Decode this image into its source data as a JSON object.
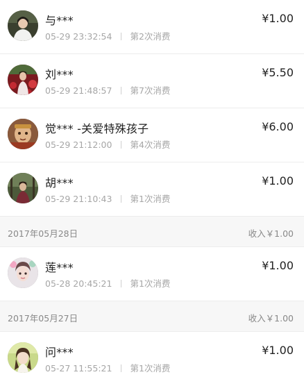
{
  "records_group_1": [
    {
      "name": "与***",
      "time": "05-29 23:32:54",
      "count": "第2次消费",
      "amount": "¥1.00",
      "avatar": "avatar-photo"
    },
    {
      "name": "刘***",
      "time": "05-29 21:48:57",
      "count": "第7次消费",
      "amount": "¥5.50",
      "avatar": "avatar-photo"
    },
    {
      "name": "觉*** -关爱特殊孩子",
      "time": "05-29 21:12:00",
      "count": "第4次消费",
      "amount": "¥6.00",
      "avatar": "avatar-photo"
    },
    {
      "name": "胡***",
      "time": "05-29 21:10:43",
      "count": "第1次消费",
      "amount": "¥1.00",
      "avatar": "avatar-photo"
    }
  ],
  "date_header_1": {
    "date": "2017年05月28日",
    "income": "收入￥1.00"
  },
  "records_group_2": [
    {
      "name": "莲***",
      "time": "05-28 20:45:21",
      "count": "第1次消费",
      "amount": "¥1.00",
      "avatar": "avatar-photo"
    }
  ],
  "date_header_2": {
    "date": "2017年05月27日",
    "income": "收入￥1.00"
  },
  "records_group_3": [
    {
      "name": "问***",
      "time": "05-27 11:55:21",
      "count": "第1次消费",
      "amount": "¥1.00",
      "avatar": "avatar-photo"
    }
  ]
}
